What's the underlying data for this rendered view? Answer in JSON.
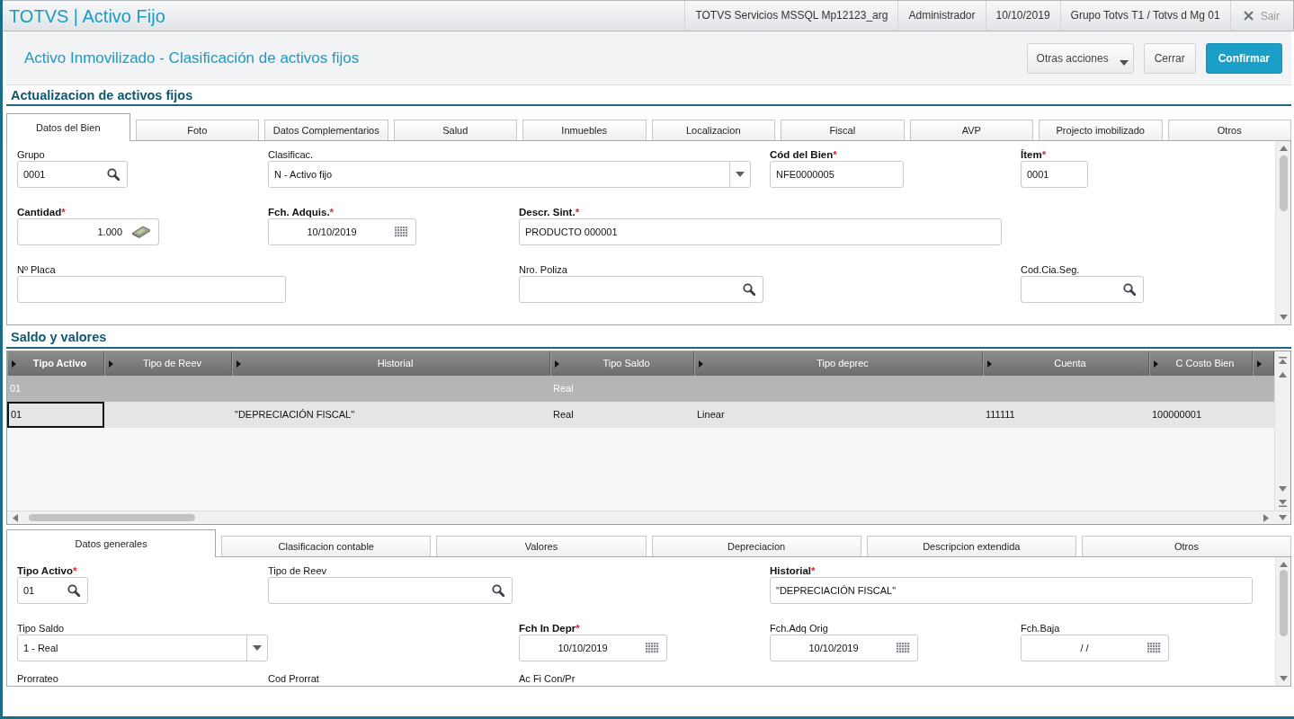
{
  "header": {
    "app_title": "TOTVS | Activo Fijo",
    "info": [
      "TOTVS Servicios MSSQL Mp12123_arg",
      "Administrador",
      "10/10/2019",
      "Grupo Totvs T1 / Totvs d Mg 01"
    ],
    "exit_label": "Sair"
  },
  "page": {
    "title": "Activo Inmovilizado - Clasificación de activos fijos",
    "buttons": [
      {
        "label": "Otras acciones",
        "kind": "menu"
      },
      {
        "label": "Cerrar",
        "kind": "secondary"
      },
      {
        "label": "Confirmar",
        "kind": "primary"
      }
    ]
  },
  "asset": {
    "title": "Actualizacion de activos fijos",
    "tabs": [
      {
        "label": "Datos del Bien",
        "selected": true
      },
      {
        "label": "Foto",
        "selected": false
      },
      {
        "label": "Datos Complementarios",
        "selected": false
      },
      {
        "label": "Salud",
        "selected": false
      },
      {
        "label": "Inmuebles",
        "selected": false
      },
      {
        "label": "Localizacion",
        "selected": false
      },
      {
        "label": "Fiscal",
        "selected": false
      },
      {
        "label": "AVP",
        "selected": false
      },
      {
        "label": "Projecto imobilizado",
        "selected": false
      },
      {
        "label": "Otros",
        "selected": false
      }
    ],
    "form_rows": [
      [
        {
          "label": "Grupo",
          "kind": "lookup",
          "value": "0001"
        },
        {
          "label": "Clasificac.",
          "kind": "select",
          "value": "N - Activo fijo"
        },
        {
          "label": "Cód del Bien",
          "mark": "*",
          "kind": "text",
          "value": "NFE0000005"
        },
        {
          "label": "Ítem",
          "mark": "*",
          "kind": "text",
          "value": "0001"
        }
      ],
      [
        {
          "label": "Cantidad",
          "mark": "*",
          "kind": "number",
          "value": "1.000"
        },
        {
          "label": "Fch. Adquis.",
          "mark": "*",
          "kind": "date",
          "value": "10/10/2019"
        },
        {
          "label": "Descr. Sint.",
          "mark": "*",
          "kind": "text",
          "value": "PRODUCTO 000001"
        }
      ],
      [
        {
          "label": "Nº Placa",
          "kind": "text"
        },
        {
          "label": "Nro. Poliza",
          "kind": "lookup"
        },
        {
          "label": "Cod.Cia.Seg.",
          "kind": "lookup"
        }
      ]
    ]
  },
  "balances": {
    "title": "Saldo y valores",
    "columns": [
      {
        "label": "Tipo Activo",
        "selected": true
      },
      {
        "label": "Tipo de Reev",
        "selected": false
      },
      {
        "label": "Historial",
        "selected": false
      },
      {
        "label": "Tipo Saldo",
        "selected": false
      },
      {
        "label": "Tipo deprec",
        "selected": false
      },
      {
        "label": "Cuenta",
        "selected": false
      },
      {
        "label": "C Costo Bien",
        "selected": false
      }
    ],
    "rows": [
      {
        "kind": "summary",
        "focused": false,
        "cells": [
          "01",
          null,
          null,
          "Real",
          null,
          null,
          null
        ]
      },
      {
        "kind": "data",
        "focused": true,
        "cells": [
          "01",
          null,
          "\"DEPRECIACIÓN FISCAL\"",
          "Real",
          "Linear",
          "111111",
          "100000001"
        ]
      }
    ]
  },
  "detail": {
    "tabs": [
      {
        "label": "Datos generales",
        "selected": true
      },
      {
        "label": "Clasificacion contable",
        "selected": false
      },
      {
        "label": "Valores",
        "selected": false
      },
      {
        "label": "Depreciacion",
        "selected": false
      },
      {
        "label": "Descripcion extendida",
        "selected": false
      },
      {
        "label": "Otros",
        "selected": false
      }
    ],
    "form_rows": [
      [
        {
          "label": "Tipo Activo",
          "mark": "*",
          "kind": "lookup",
          "value": "01"
        },
        {
          "label": "Tipo de Reev",
          "kind": "lookup"
        },
        {
          "label": "Historial",
          "mark": "*",
          "kind": "text",
          "value": "\"DEPRECIACIÓN FISCAL\""
        }
      ],
      [
        {
          "label": "Tipo Saldo",
          "kind": "select",
          "value": "1 - Real"
        },
        {
          "label": "Fch In Depr",
          "mark": "*",
          "kind": "date",
          "value": "10/10/2019"
        },
        {
          "label": "Fch.Adq Orig",
          "kind": "date",
          "value": "10/10/2019"
        },
        {
          "label": "Fch.Baja",
          "kind": "date",
          "value": "/ /"
        }
      ],
      [
        {
          "label": "Prorrateo",
          "kind": "clipped"
        },
        {
          "label": "Cod Prorrat",
          "kind": "clipped"
        },
        {
          "label": "Ac Fi Con/Pr",
          "kind": "clipped"
        }
      ]
    ]
  }
}
